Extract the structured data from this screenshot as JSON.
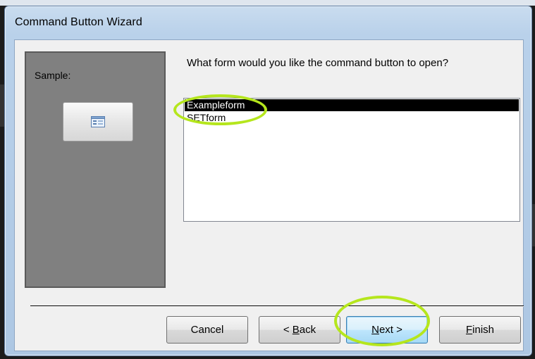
{
  "window": {
    "title": "Command Button Wizard"
  },
  "sample": {
    "label": "Sample:",
    "preview_icon": "form-icon"
  },
  "question": "What form would you like the command button to open?",
  "forms": [
    {
      "name": "Exampleform",
      "selected": true
    },
    {
      "name": "SETform",
      "selected": false
    }
  ],
  "buttons": {
    "cancel": "Cancel",
    "back_prefix": "< ",
    "back_mnemonic": "B",
    "back_rest": "ack",
    "next_mnemonic": "N",
    "next_rest": "ext >",
    "finish_mnemonic": "F",
    "finish_rest": "inish"
  },
  "annotations": {
    "highlight_color": "#b5e61d"
  }
}
